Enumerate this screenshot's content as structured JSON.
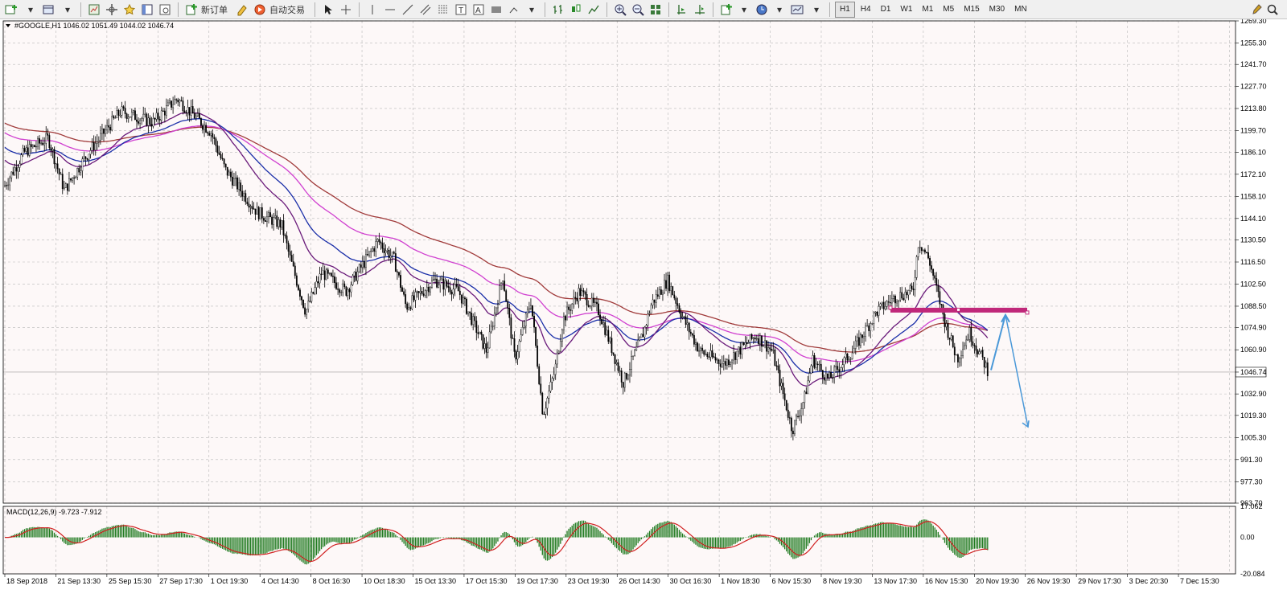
{
  "toolbar": {
    "new_order_label": "新订单",
    "auto_trade_label": "自动交易",
    "timeframes": [
      "H1",
      "H4",
      "D1",
      "W1",
      "M1",
      "M5",
      "M15",
      "M30",
      "MN"
    ],
    "active_timeframe": "H1"
  },
  "chart": {
    "symbol_header": "#GOOGLE,H1  1046.02 1051.49 1044.02 1046.74",
    "current_price_label": "1046.74",
    "background": "#fdf8f8",
    "grid_color": "#b8b8b8",
    "ma_colors": [
      "#a03a3a",
      "#d040d0",
      "#1a2ea8",
      "#6a1a7a"
    ],
    "resistance_color": "#c0287a",
    "arrow_color": "#4a98d8"
  },
  "chart_data": {
    "type": "candlestick",
    "y_ticks": [
      "1269.30",
      "1255.30",
      "1241.70",
      "1227.70",
      "1213.80",
      "1199.70",
      "1186.10",
      "1172.10",
      "1158.10",
      "1144.10",
      "1130.50",
      "1116.50",
      "1102.50",
      "1088.50",
      "1074.90",
      "1060.90",
      "1046.74",
      "1032.90",
      "1019.30",
      "1005.30",
      "991.30",
      "977.30",
      "963.70"
    ],
    "ylim": [
      963.7,
      1269.3
    ],
    "x_ticks": [
      "18 Sep 2018",
      "21 Sep 13:30",
      "25 Sep 15:30",
      "27 Sep 17:30",
      "1 Oct 19:30",
      "4 Oct 14:30",
      "8 Oct 16:30",
      "10 Oct 18:30",
      "15 Oct 13:30",
      "17 Oct 15:30",
      "19 Oct 17:30",
      "23 Oct 19:30",
      "26 Oct 14:30",
      "30 Oct 16:30",
      "1 Nov 18:30",
      "6 Nov 15:30",
      "8 Nov 19:30",
      "13 Nov 17:30",
      "16 Nov 15:30",
      "20 Nov 19:30",
      "26 Nov 19:30",
      "29 Nov 17:30",
      "3 Dec 20:30",
      "7 Dec 15:30"
    ],
    "price_path": [
      [
        0,
        1160
      ],
      [
        30,
        1186
      ],
      [
        60,
        1195
      ],
      [
        80,
        1162
      ],
      [
        110,
        1186
      ],
      [
        150,
        1212
      ],
      [
        190,
        1205
      ],
      [
        220,
        1220
      ],
      [
        262,
        1199
      ],
      [
        280,
        1175
      ],
      [
        320,
        1148
      ],
      [
        350,
        1140
      ],
      [
        360,
        1120
      ],
      [
        380,
        1085
      ],
      [
        400,
        1110
      ],
      [
        430,
        1098
      ],
      [
        470,
        1130
      ],
      [
        490,
        1118
      ],
      [
        505,
        1088
      ],
      [
        540,
        1105
      ],
      [
        570,
        1098
      ],
      [
        605,
        1060
      ],
      [
        625,
        1108
      ],
      [
        640,
        1055
      ],
      [
        660,
        1092
      ],
      [
        675,
        1020
      ],
      [
        690,
        1048
      ],
      [
        700,
        1080
      ],
      [
        720,
        1098
      ],
      [
        745,
        1085
      ],
      [
        775,
        1040
      ],
      [
        800,
        1072
      ],
      [
        810,
        1090
      ],
      [
        830,
        1105
      ],
      [
        850,
        1080
      ],
      [
        870,
        1060
      ],
      [
        900,
        1052
      ],
      [
        940,
        1070
      ],
      [
        960,
        1060
      ],
      [
        985,
        1010
      ],
      [
        1000,
        1030
      ],
      [
        1010,
        1055
      ],
      [
        1030,
        1042
      ],
      [
        1060,
        1060
      ],
      [
        1090,
        1085
      ],
      [
        1115,
        1095
      ],
      [
        1135,
        1098
      ],
      [
        1142,
        1130
      ],
      [
        1155,
        1118
      ],
      [
        1175,
        1078
      ],
      [
        1190,
        1055
      ],
      [
        1205,
        1072
      ],
      [
        1228,
        1048
      ]
    ],
    "overlays": [
      "resistance-zone ~1086",
      "up-arrow to ~1083",
      "down-arrow to ~1012"
    ],
    "macd": {
      "label": "MACD(12,26,9) -9.723 -7.912",
      "y_ticks": [
        "17.062",
        "0.00",
        "-20.084"
      ],
      "ylim": [
        -20.084,
        17.062
      ]
    }
  }
}
